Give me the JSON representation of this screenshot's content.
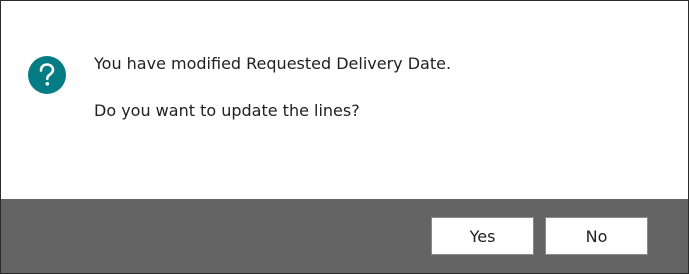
{
  "dialog": {
    "icon": "question-icon",
    "message_line1": "You have modified Requested Delivery Date.",
    "message_line2": "Do you want to update the lines?",
    "buttons": {
      "yes_label": "Yes",
      "no_label": "No"
    }
  },
  "colors": {
    "icon_background": "#037c84",
    "footer_background": "#646464",
    "text": "#212121"
  }
}
